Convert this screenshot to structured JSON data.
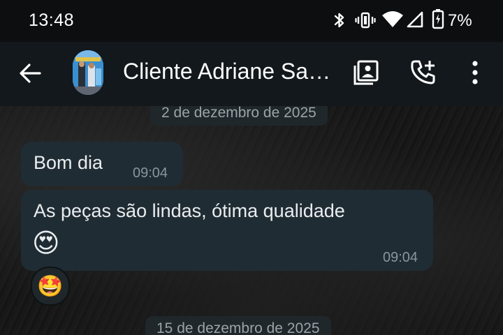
{
  "status_bar": {
    "time": "13:48",
    "battery_percent": "7%",
    "icons": [
      "bluetooth-icon",
      "vibrate-icon",
      "wifi-icon",
      "cellular-signal-icon",
      "battery-charging-icon"
    ]
  },
  "app_bar": {
    "contact_name": "Cliente Adriane Sa…",
    "actions": [
      "contact-card-icon",
      "add-call-icon",
      "more-vert-icon"
    ]
  },
  "chat": {
    "date_separators": [
      "2 de dezembro de 2025",
      "15 de dezembro de 2025"
    ],
    "messages": [
      {
        "text": "Bom dia",
        "time": "09:04"
      },
      {
        "text": "As peças são lindas, ótima qualidade",
        "emoji": "😍",
        "time": "09:04"
      }
    ],
    "reaction": "🤩"
  },
  "colors": {
    "status_bar_bg": "#0c0e10",
    "app_bar_bg": "#12181c",
    "bubble_bg": "#202c33",
    "date_chip_bg": "#1f272b",
    "timestamp_text": "#8696a0"
  }
}
